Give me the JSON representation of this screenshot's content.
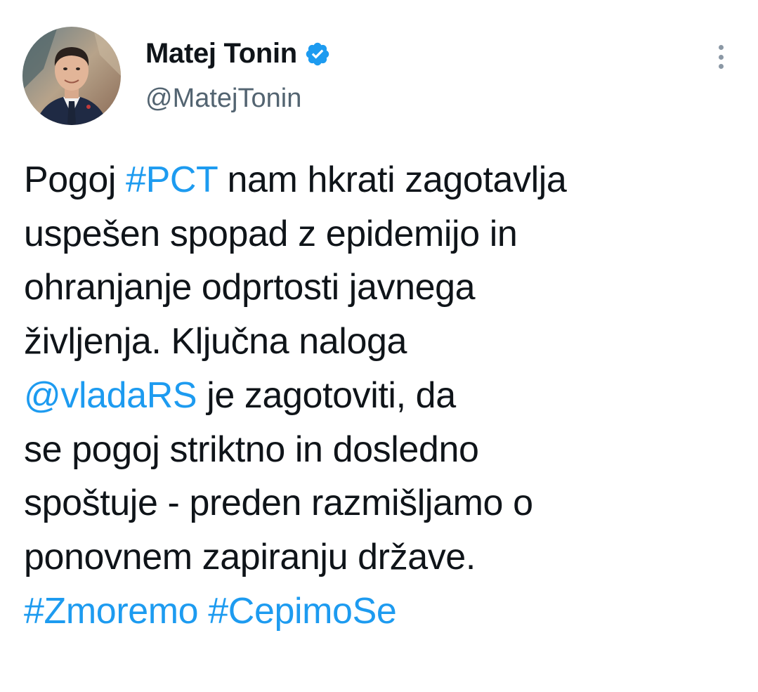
{
  "author": {
    "display_name": "Matej Tonin",
    "handle": "@MatejTonin",
    "verified": true,
    "avatar_icon": "avatar-photo"
  },
  "colors": {
    "link": "#1d9bf0",
    "text": "#0f1419",
    "secondary": "#536471",
    "background": "#ffffff"
  },
  "tweet": {
    "line1": {
      "a": "Pogoj ",
      "hashtag_pct": "#PCT",
      "b": " nam hkrati zagotavlja"
    },
    "line2": "uspešen spopad z epidemijo in",
    "line3": "ohranjanje odprtosti javnega",
    "line4": "življenja. Ključna naloga",
    "line5": {
      "mention": "@vladaRS",
      "b": " je zagotoviti, da"
    },
    "line6": "se pogoj striktno in dosledno",
    "line7": "spoštuje - preden razmišljamo o",
    "line8": "ponovnem zapiranju države.",
    "hashtags": [
      "#Zmoremo",
      "#CepimoSe"
    ]
  },
  "icons": {
    "verified": "verified-badge-icon",
    "more": "more-options-icon"
  }
}
